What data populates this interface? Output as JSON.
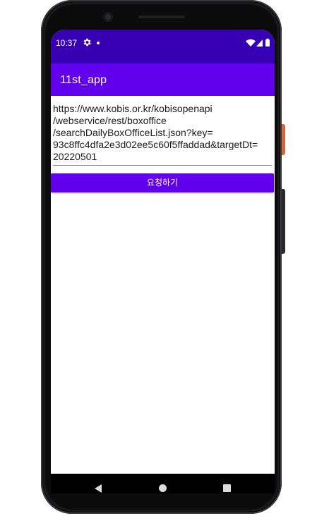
{
  "status_bar": {
    "time": "10:37",
    "icons": [
      "gear-icon",
      "notification-dot-icon",
      "wifi-icon",
      "signal-icon",
      "battery-icon"
    ]
  },
  "app_bar": {
    "title": "11st_app"
  },
  "main": {
    "url_input_value": "https://www.kobis.or.kr/kobisopenapi\n/webservice/rest/boxoffice\n/searchDailyBoxOfficeList.json?key=\n93c8ffc4dfa2e3d02ee5c60f5ffaddad&targetDt=\n20220501",
    "request_button_label": "요청하기"
  },
  "nav_bar": {
    "icons": [
      "back-icon",
      "home-icon",
      "recents-icon"
    ]
  },
  "colors": {
    "status_bar": "#3700b3",
    "app_bar": "#6200ee",
    "button": "#6200ee",
    "phone_body": "#1b1b1d",
    "power_button_accent": "#d4663a"
  }
}
